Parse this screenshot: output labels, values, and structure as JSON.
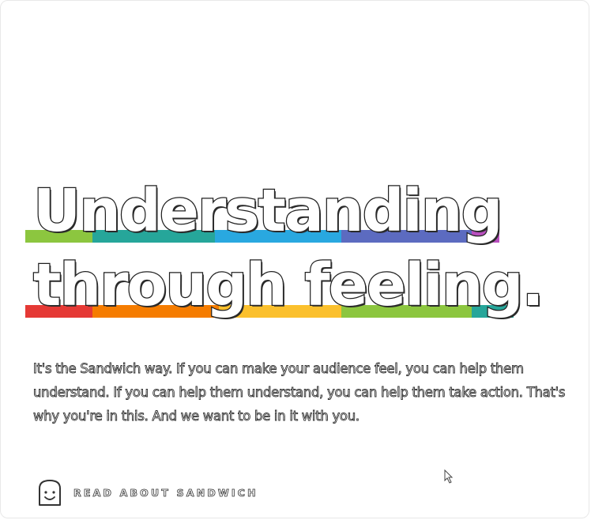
{
  "headline": {
    "line1": "Understanding",
    "line2": "through feeling."
  },
  "body_text": "It's the Sandwich way. If you can make your audience feel, you can help them understand. If you can help them understand, you can help them take action. That's why you're in this. And we want to be in it with you.",
  "cta": {
    "label": "READ ABOUT SANDWICH",
    "icon": "toast-smiley-icon"
  },
  "colors": {
    "stripe_line1": [
      "#8cc63f",
      "#26a69a",
      "#29a8e0",
      "#5c6bc0",
      "#b84fbe"
    ],
    "stripe_line2": [
      "#e53935",
      "#f57c00",
      "#fbc02d",
      "#8cc63f",
      "#26a69a"
    ],
    "text_outline": "#1f1f1f"
  }
}
